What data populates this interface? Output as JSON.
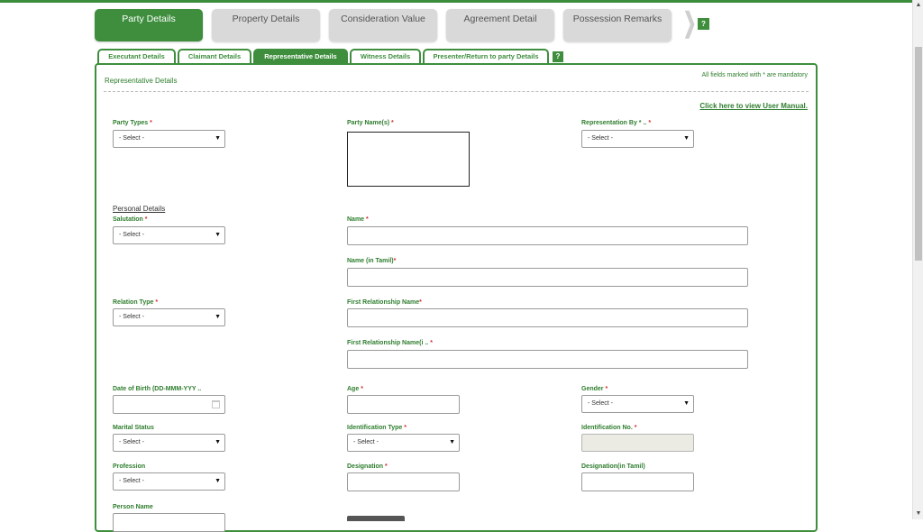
{
  "main_tabs": [
    {
      "label": "Party Details",
      "active": true
    },
    {
      "label": "Property Details",
      "active": false
    },
    {
      "label": "Consideration Value",
      "active": false
    },
    {
      "label": "Agreement Detail",
      "active": false
    },
    {
      "label": "Possession Remarks",
      "active": false
    }
  ],
  "help_label": "?",
  "sub_tabs": [
    {
      "label": "Executant Details",
      "active": false
    },
    {
      "label": "Claimant Details",
      "active": false
    },
    {
      "label": "Representative Details",
      "active": true
    },
    {
      "label": "Witness Details",
      "active": false
    },
    {
      "label": "Presenter/Return to party Details",
      "active": false
    }
  ],
  "section_title": "Representative Details",
  "mandatory_note": "All fields marked with * are mandatory",
  "manual_link": "Click here to view User Manual.",
  "personal_details_title": "Personal Details",
  "required_mark": "*",
  "fields": {
    "party_types": {
      "label": "Party Types",
      "value": "- Select -"
    },
    "party_names": {
      "label": "Party Name(s)"
    },
    "representation_by": {
      "label": "Representation By * ..",
      "value": "- Select -"
    },
    "salutation": {
      "label": "Salutation",
      "value": "- Select -"
    },
    "name": {
      "label": "Name",
      "value": ""
    },
    "name_tamil": {
      "label": "Name (in Tamil)",
      "value": ""
    },
    "relation_type": {
      "label": "Relation Type",
      "value": "- Select -"
    },
    "first_relationship_name": {
      "label": "First Relationship Name",
      "value": ""
    },
    "first_relationship_name_tamil": {
      "label": "First Relationship Name(i ..",
      "value": ""
    },
    "date_of_birth": {
      "label": "Date of Birth (DD-MMM-YYY ..",
      "value": ""
    },
    "age": {
      "label": "Age",
      "value": ""
    },
    "gender": {
      "label": "Gender",
      "value": "- Select -"
    },
    "marital_status": {
      "label": "Marital Status",
      "value": "- Select -"
    },
    "identification_type": {
      "label": "Identification Type",
      "value": "- Select -"
    },
    "identification_no": {
      "label": "Identification No.",
      "value": ""
    },
    "profession": {
      "label": "Profession",
      "value": "- Select -"
    },
    "designation": {
      "label": "Designation",
      "value": ""
    },
    "designation_tamil": {
      "label": "Designation(in Tamil)",
      "value": ""
    },
    "person_name": {
      "label": "Person Name",
      "value": ""
    }
  },
  "caret_glyph": "▼",
  "colors": {
    "accent": "#3e8e3e",
    "label": "#2e7d2e",
    "required": "#d32f2f",
    "inactive_tab": "#d9d9d9"
  }
}
